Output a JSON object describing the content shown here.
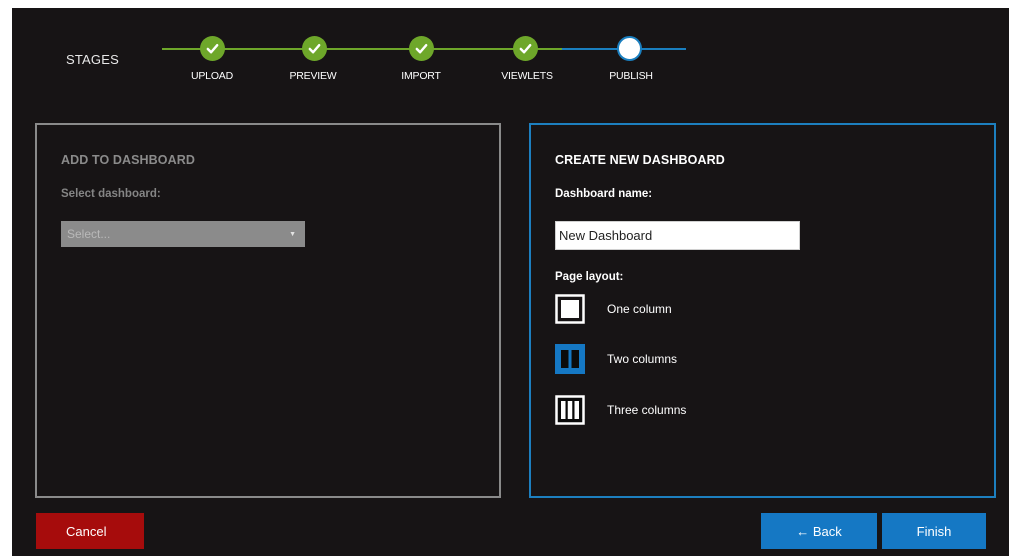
{
  "stages": {
    "label": "STAGES",
    "steps": [
      {
        "label": "UPLOAD",
        "status": "complete"
      },
      {
        "label": "PREVIEW",
        "status": "complete"
      },
      {
        "label": "IMPORT",
        "status": "complete"
      },
      {
        "label": "VIEWLETS",
        "status": "complete"
      },
      {
        "label": "PUBLISH",
        "status": "current"
      }
    ]
  },
  "add_to_dashboard": {
    "title": "ADD TO DASHBOARD",
    "select_label": "Select dashboard:",
    "select_value": "Select...",
    "disabled": true
  },
  "create_new_dashboard": {
    "title": "CREATE NEW DASHBOARD",
    "name_label": "Dashboard name:",
    "name_value": "New Dashboard",
    "layout_label": "Page layout:",
    "layout_options": [
      {
        "label": "One column",
        "icon": "one-column-layout-icon",
        "selected": false
      },
      {
        "label": "Two columns",
        "icon": "two-columns-layout-icon",
        "selected": true
      },
      {
        "label": "Three columns",
        "icon": "three-columns-layout-icon",
        "selected": false
      }
    ]
  },
  "buttons": {
    "cancel": "Cancel",
    "back": "← Back",
    "finish": "Finish"
  },
  "colors": {
    "background": "#171415",
    "complete": "#6ea72a",
    "accent": "#1578c4",
    "cancel": "#a60c0c"
  }
}
